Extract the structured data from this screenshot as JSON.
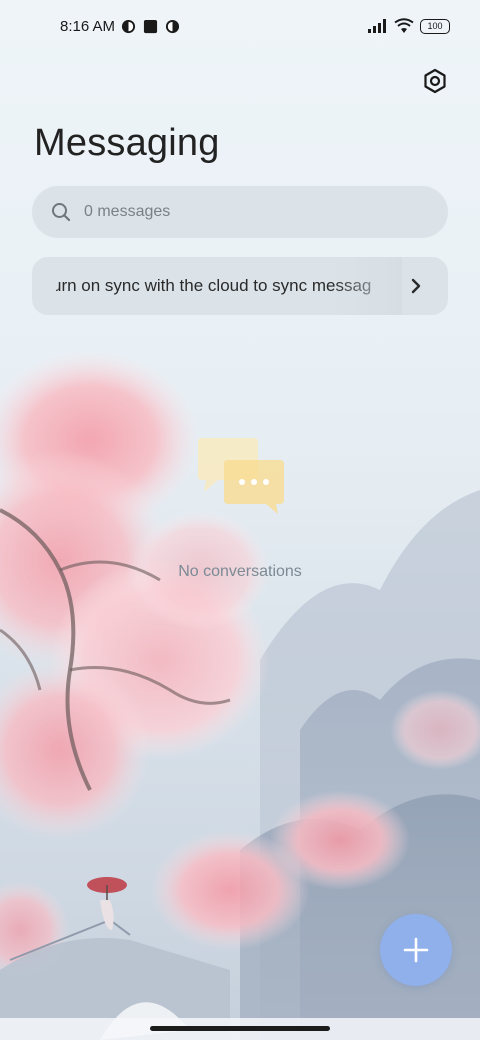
{
  "status_bar": {
    "time": "8:16 AM",
    "battery": "100",
    "icons": [
      "notification-circle-icon",
      "square-app-icon",
      "notification-circle-icon",
      "signal-icon",
      "wifi-icon",
      "battery-icon"
    ]
  },
  "header": {
    "title": "Messaging",
    "settings_icon": "settings-hexagon-icon"
  },
  "search": {
    "placeholder": "0 messages",
    "value": ""
  },
  "sync_banner": {
    "text": "Turn on sync with the cloud to sync messages",
    "visible_text": "urn on sync with the cloud to sync messag"
  },
  "empty_state": {
    "text": "No conversations",
    "icon": "chat-bubbles-icon"
  },
  "fab": {
    "icon": "plus-icon",
    "color": "#8fb0ea"
  },
  "colors": {
    "background": "#eef4f8",
    "surface": "#d6dee4",
    "accent": "#8fb0ea",
    "blossom": "#f4a9b3"
  }
}
